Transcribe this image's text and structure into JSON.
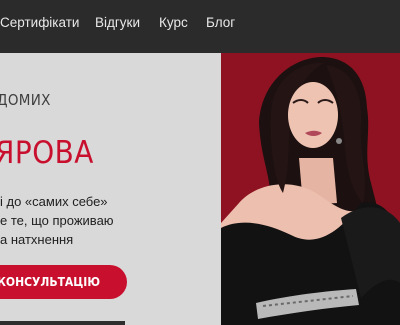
{
  "nav": {
    "items": [
      {
        "label": "Сертифікати"
      },
      {
        "label": "Відгуки"
      },
      {
        "label": "Курс"
      },
      {
        "label": "Блог"
      }
    ]
  },
  "hero": {
    "eyebrow": "ДОМИХ",
    "name": "ЯРОВА",
    "description": [
      "і до «самих себе»",
      "е те, що проживаю",
      "а натхнення"
    ],
    "cta_label": "ь НА КОНСУЛЬТАЦІЮ"
  },
  "colors": {
    "accent": "#c8102e",
    "nav_background": "#2b2b2b",
    "photo_background": "#8e1221"
  }
}
